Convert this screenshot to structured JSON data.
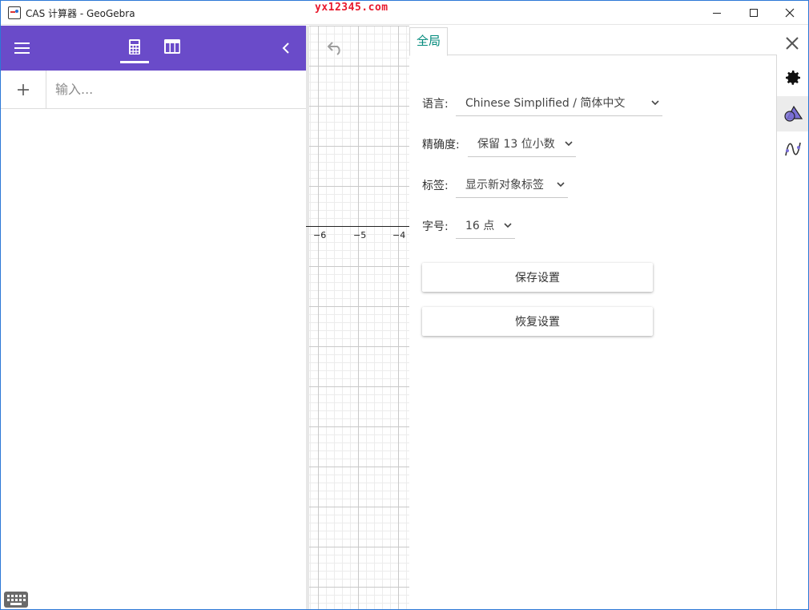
{
  "window": {
    "title": "CAS 计算器 - GeoGebra",
    "watermark": "yx12345.com"
  },
  "algebra": {
    "input_placeholder": "输入..."
  },
  "graphics": {
    "x_ticks": [
      "−6",
      "−5",
      "−4"
    ]
  },
  "settings": {
    "tab_label": "全局",
    "rows": [
      {
        "label": "语言:",
        "value": "Chinese Simplified / 简体中文"
      },
      {
        "label": "精确度:",
        "value": "保留 13 位小数"
      },
      {
        "label": "标签:",
        "value": "显示新对象标签"
      },
      {
        "label": "字号:",
        "value": "16 点"
      }
    ],
    "save_button": "保存设置",
    "restore_button": "恢复设置"
  },
  "colors": {
    "header": "#6a4bc9",
    "accent_tab": "#00897b",
    "watermark": "#e8192c"
  }
}
